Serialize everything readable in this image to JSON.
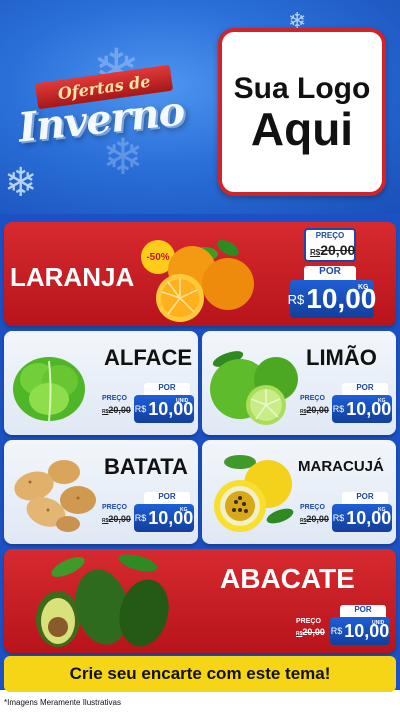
{
  "header": {
    "title_ribbon": "Ofertas de",
    "title_word": "Inverno",
    "logo_line1": "Sua Logo",
    "logo_line2": "Aqui"
  },
  "labels": {
    "preco": "PREÇO",
    "por": "POR",
    "currency": "R$"
  },
  "products": [
    {
      "name": "LARANJA",
      "discount": "-50%",
      "old_price": "20,00",
      "new_price": "10,00",
      "unit": "KG"
    },
    {
      "name": "ALFACE",
      "old_price": "20,00",
      "new_price": "10,00",
      "unit": "UNID"
    },
    {
      "name": "LIMÃO",
      "old_price": "20,00",
      "new_price": "10,00",
      "unit": "KG"
    },
    {
      "name": "BATATA",
      "old_price": "20,00",
      "new_price": "10,00",
      "unit": "KG"
    },
    {
      "name": "MARACUJÁ",
      "old_price": "20,00",
      "new_price": "10,00",
      "unit": "KG"
    },
    {
      "name": "ABACATE",
      "old_price": "20,00",
      "new_price": "10,00",
      "unit": "UNID"
    }
  ],
  "cta": "Crie seu encarte com este tema!",
  "footnote": "*Imagens Meramente Ilustrativas",
  "icons": [
    "snowflake-icon",
    "orange-icon",
    "lettuce-icon",
    "lime-icon",
    "potato-icon",
    "passion-fruit-icon",
    "avocado-icon"
  ]
}
